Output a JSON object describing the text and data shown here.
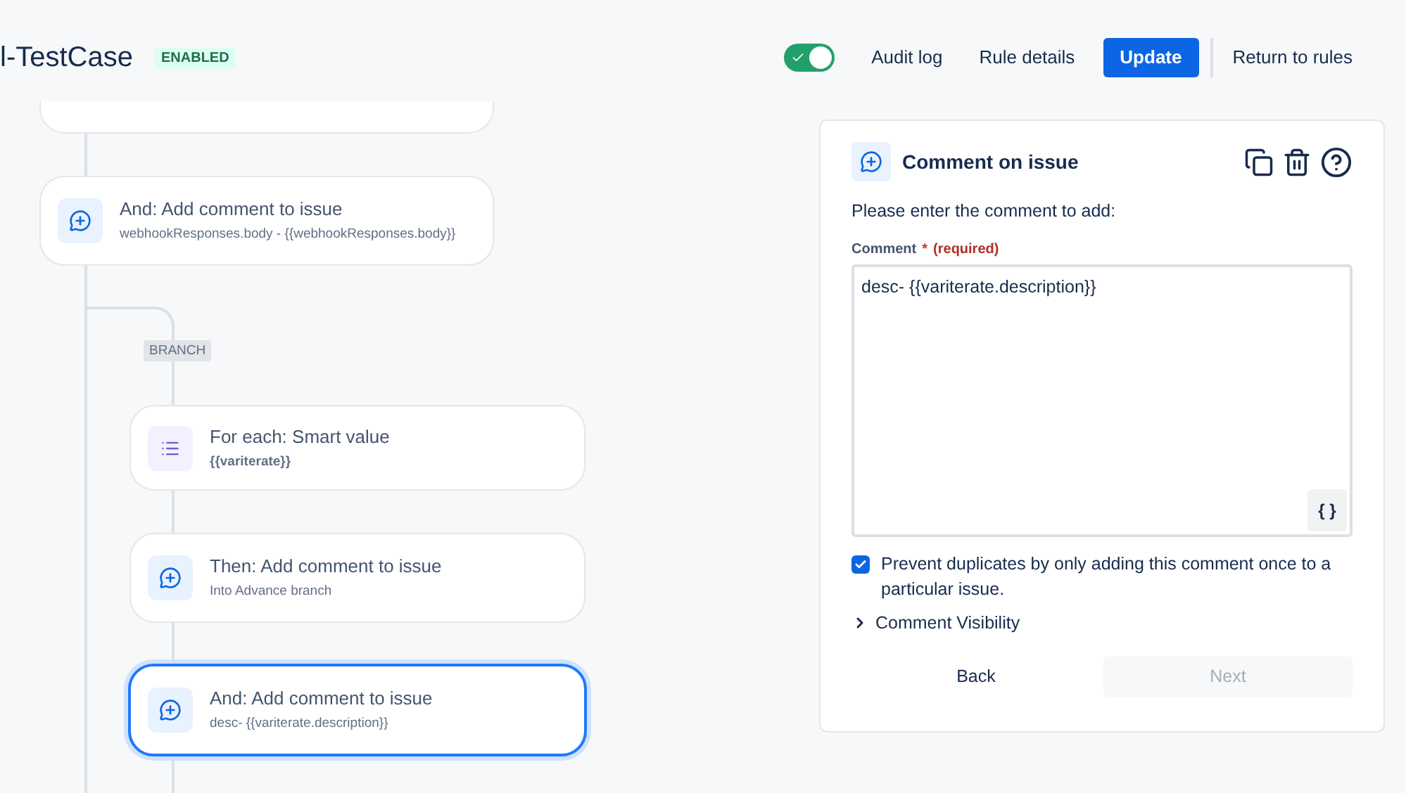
{
  "header": {
    "title": "l-TestCase",
    "status": "ENABLED",
    "rule_toggle": {
      "on": true
    },
    "actions": [
      {
        "label": "Audit log",
        "kind": "link"
      },
      {
        "label": "Rule details",
        "kind": "link"
      },
      {
        "label": "Update",
        "kind": "primary"
      },
      {
        "label": "Return to rules",
        "kind": "link"
      }
    ]
  },
  "canvas": {
    "nodes": [
      {
        "title": "And: Add comment to issue",
        "detail": "webhookResponses.body - {{webhookResponses.body}}",
        "kind": "comment",
        "detail_bold": false,
        "selected": false
      }
    ],
    "branch": {
      "label": "BRANCH",
      "children": [
        {
          "title": "For each: Smart value",
          "detail": "{{variterate}}",
          "kind": "list",
          "detail_bold": true,
          "selected": false
        },
        {
          "title": "Then: Add comment to issue",
          "detail": "Into Advance branch",
          "kind": "comment",
          "detail_bold": false,
          "selected": false
        },
        {
          "title": "And: Add comment to issue",
          "detail": "desc- {{variterate.description}}",
          "kind": "comment",
          "detail_bold": false,
          "selected": true
        }
      ]
    }
  },
  "panel": {
    "title": "Comment on issue",
    "intro": "Please enter the comment to add:",
    "field": {
      "label": "Comment",
      "required_mark": "*",
      "required_note": "(required)",
      "value": "desc- {{variterate.description}}",
      "smart_value_button": "{ }"
    },
    "prevent_duplicates": {
      "label": "Prevent duplicates by only adding this comment once to a particular issue.",
      "checked": true
    },
    "visibility": {
      "label": "Comment Visibility",
      "expanded": false
    },
    "buttons": [
      {
        "label": "Back",
        "disabled": false
      },
      {
        "label": "Next",
        "disabled": true
      }
    ]
  }
}
